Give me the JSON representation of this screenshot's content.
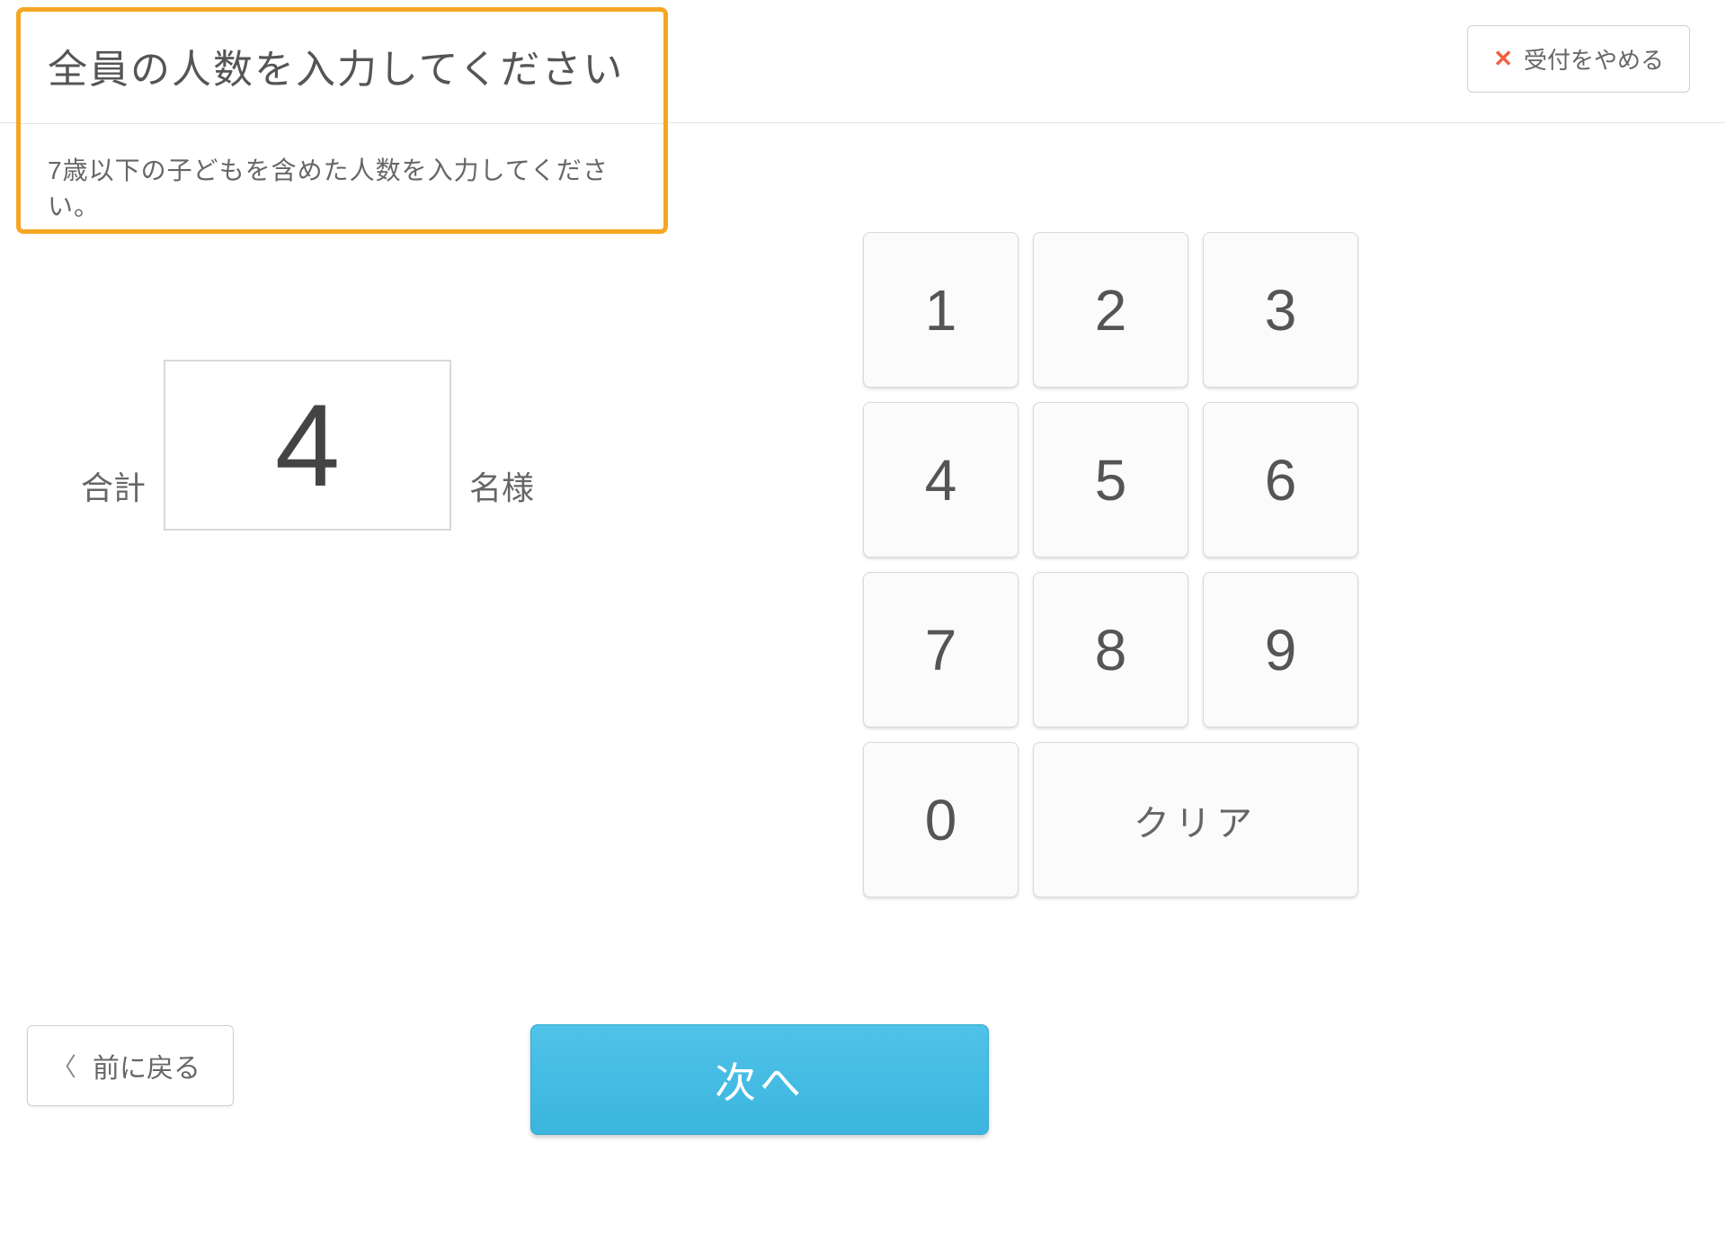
{
  "header": {
    "title": "全員の人数を入力してください",
    "subtitle": "7歳以下の子どもを含めた人数を入力してください。"
  },
  "cancel": {
    "label": "受付をやめる"
  },
  "total": {
    "label_left": "合計",
    "value": "4",
    "label_right": "名様"
  },
  "keypad": {
    "keys": [
      "1",
      "2",
      "3",
      "4",
      "5",
      "6",
      "7",
      "8",
      "9",
      "0"
    ],
    "clear_label": "クリア"
  },
  "footer": {
    "back_label": "前に戻る",
    "next_label": "次へ"
  }
}
